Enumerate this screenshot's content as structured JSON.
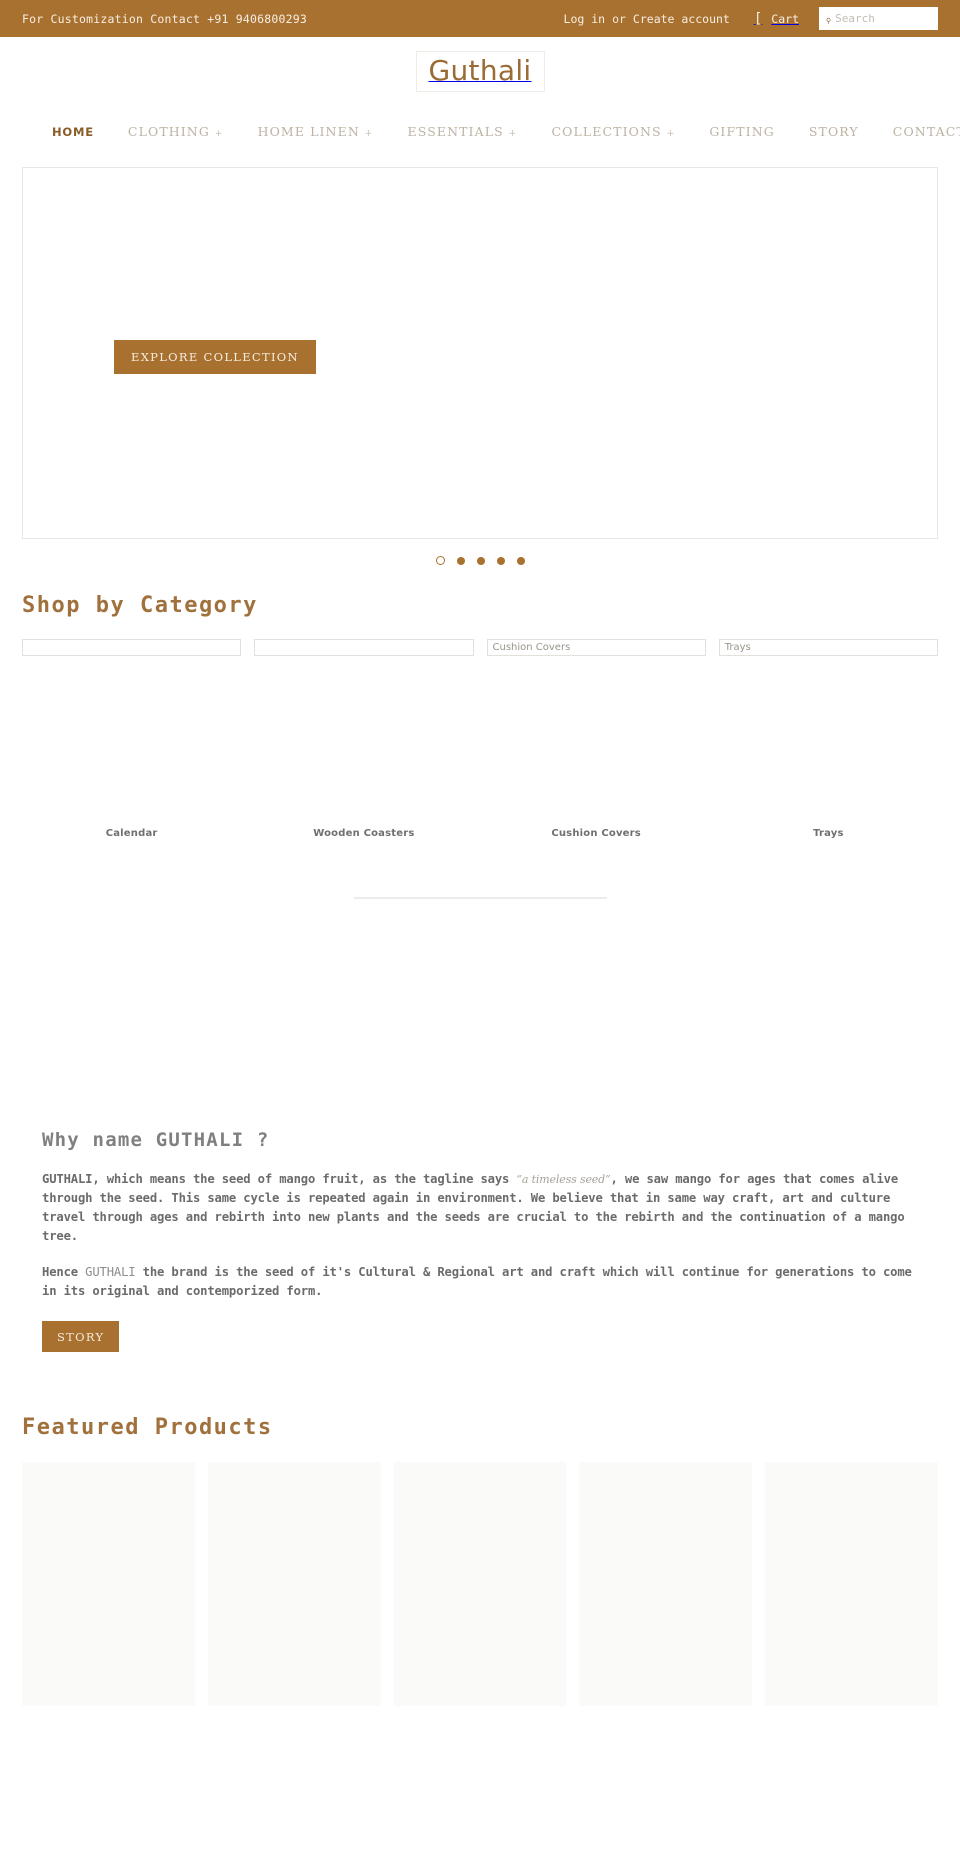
{
  "announcement": {
    "text": "For Customization Contact +91 9406800293",
    "login_label": "Log in",
    "separator": "or",
    "create_account_label": "Create account",
    "cart_icon": "cart-bracket-icon",
    "cart_label": "Cart",
    "search_icon": "search-icon",
    "search_placeholder": "Search",
    "search_value": "",
    "bar_color": "#a9712f"
  },
  "logo": {
    "text": "Guthali",
    "color": "#9a6b35"
  },
  "nav": {
    "items": [
      {
        "label": "HOME",
        "caret": "",
        "active": true
      },
      {
        "label": "CLOTHING",
        "caret": "+",
        "active": false
      },
      {
        "label": "HOME LINEN",
        "caret": "+",
        "active": false
      },
      {
        "label": "ESSENTIALS",
        "caret": "+",
        "active": false
      },
      {
        "label": "COLLECTIONS",
        "caret": "+",
        "active": false
      },
      {
        "label": "GIFTING",
        "caret": "",
        "active": false
      },
      {
        "label": "STORY",
        "caret": "",
        "active": false
      },
      {
        "label": "CONTACT US",
        "caret": "",
        "active": false
      }
    ]
  },
  "hero": {
    "button_label": "EXPLORE COLLECTION",
    "button_color": "#a9712f",
    "slide_count": 5,
    "active_slide": 1
  },
  "category_section": {
    "heading": "Shop by Category",
    "items": [
      {
        "alt": "",
        "label": "Calendar"
      },
      {
        "alt": "",
        "label": "Wooden Coasters"
      },
      {
        "alt": "Cushion Covers",
        "label": "Cushion Covers"
      },
      {
        "alt": "Trays",
        "label": "Trays"
      }
    ]
  },
  "story": {
    "heading": "Why name GUTHALI ?",
    "paragraph1_part1": "GUTHALI, which means the seed of mango fruit, as the tagline says ",
    "paragraph1_tagline": "“a timeless seed”",
    "paragraph1_part2": ", we saw mango for ages that comes alive through the seed. This same cycle is repeated again in environment. We believe that in same way craft, art and culture travel through ages and rebirth into new plants and the seeds are crucial to the rebirth and the continuation of a mango tree.",
    "paragraph2_part1": "Hence ",
    "paragraph2_brand": "GUTHALI",
    "paragraph2_part2": " the brand is the seed of it's Cultural & Regional art and craft which will continue for generations to come in its original and contemporized form.",
    "button_label": "STORY"
  },
  "featured": {
    "heading": "Featured Products",
    "card_count": 5
  }
}
